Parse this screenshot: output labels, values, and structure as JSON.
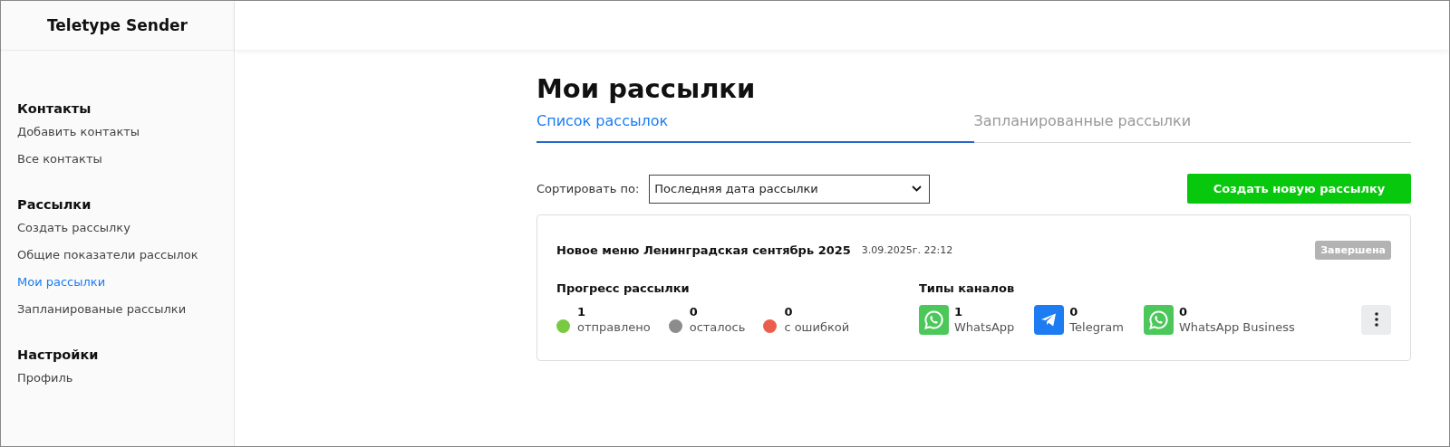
{
  "app_title": "Teletype Sender",
  "sidebar": {
    "sections": [
      {
        "heading": "Контакты",
        "items": [
          {
            "label": "Добавить контакты",
            "selected": false
          },
          {
            "label": "Все контакты",
            "selected": false
          }
        ]
      },
      {
        "heading": "Рассылки",
        "items": [
          {
            "label": "Создать рассылку",
            "selected": false
          },
          {
            "label": "Общие показатели рассылок",
            "selected": false
          },
          {
            "label": "Мои рассылки",
            "selected": true
          },
          {
            "label": "Запланированые рассылки",
            "selected": false
          }
        ]
      },
      {
        "heading": "Настройки",
        "items": [
          {
            "label": "Профиль",
            "selected": false
          }
        ]
      }
    ]
  },
  "page_title": "Мои рассылки",
  "tabs": [
    {
      "label": "Список рассылок",
      "selected": true
    },
    {
      "label": "Запланированные рассылки",
      "selected": false
    }
  ],
  "sort": {
    "label": "Сортировать по:",
    "value": "Последняя дата рассылки"
  },
  "create_button": "Создать новую рассылку",
  "mailings": [
    {
      "name": "Новое меню Ленинградская сентябрь 2025",
      "date": "3.09.2025г. 22:12",
      "status": "Завершена",
      "progress_heading": "Прогресс рассылки",
      "progress": [
        {
          "count": "1",
          "label": "отправлено",
          "color": "#7ac943"
        },
        {
          "count": "0",
          "label": "осталось",
          "color": "#8c8c8c"
        },
        {
          "count": "0",
          "label": "с ошибкой",
          "color": "#eb5e4b"
        }
      ],
      "channels_heading": "Типы каналов",
      "channels": [
        {
          "kind": "whatsapp",
          "count": "1",
          "label": "WhatsApp"
        },
        {
          "kind": "telegram",
          "count": "0",
          "label": "Telegram"
        },
        {
          "kind": "whatsapp",
          "count": "0",
          "label": "WhatsApp Business"
        }
      ]
    }
  ]
}
